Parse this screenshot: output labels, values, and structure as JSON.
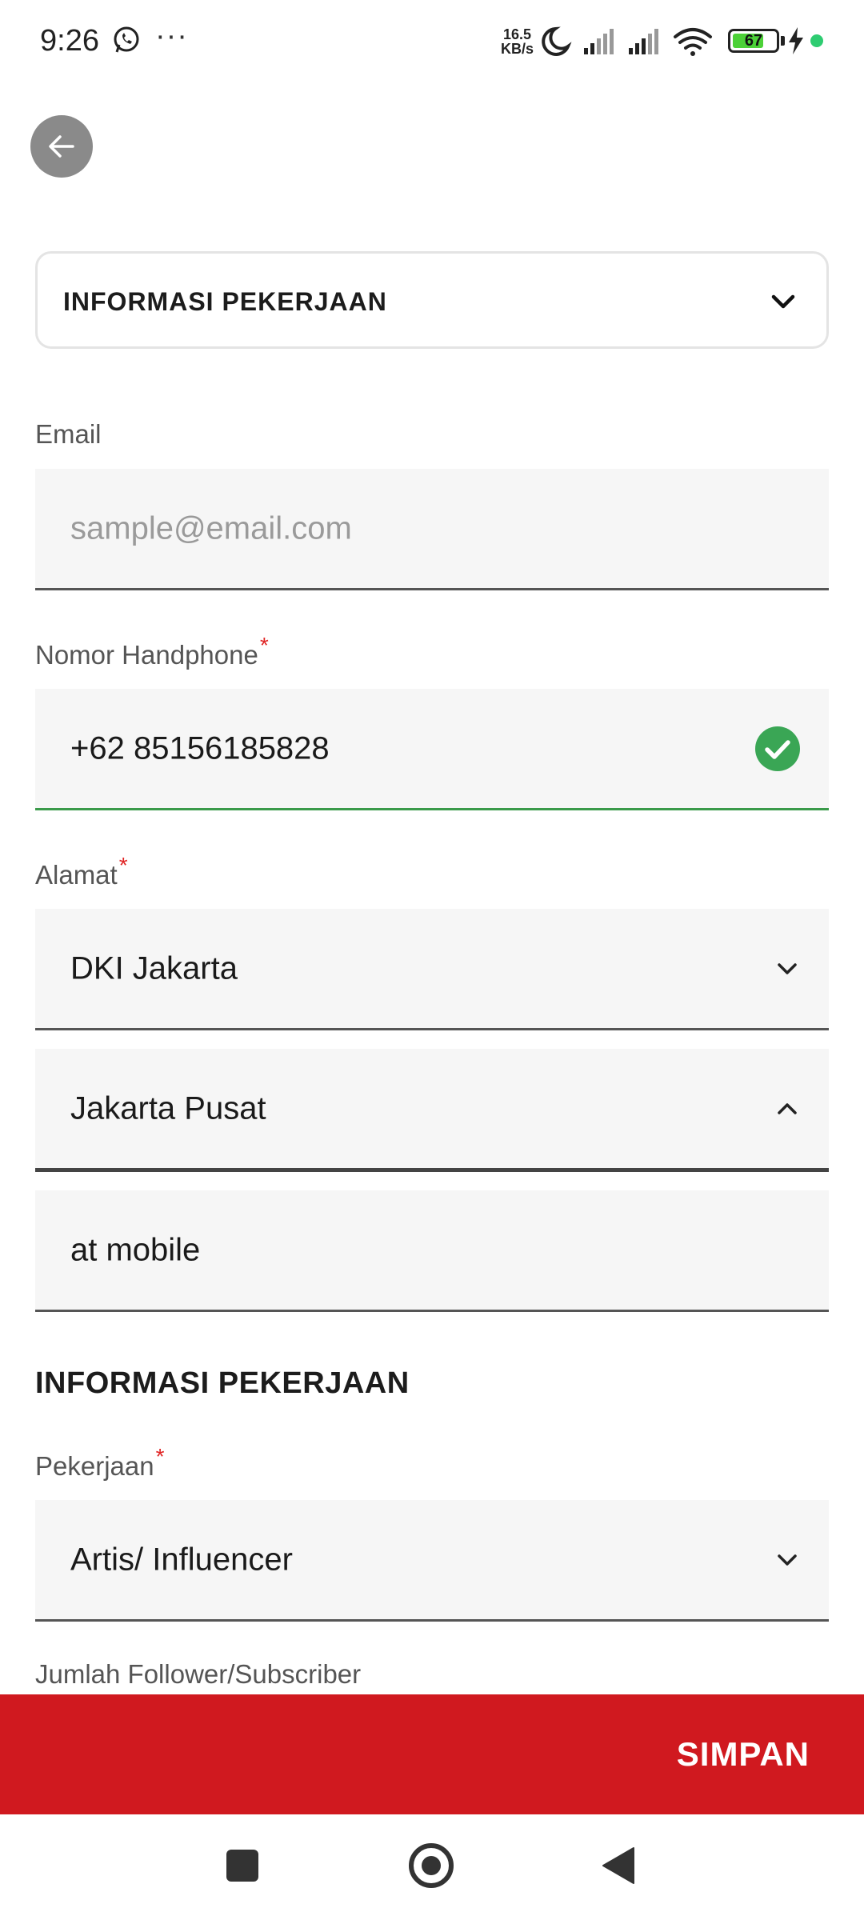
{
  "status_bar": {
    "time": "9:26",
    "more": "···",
    "speed_value": "16.5",
    "speed_unit": "KB/s",
    "battery": "67"
  },
  "accordion": {
    "title": "INFORMASI PEKERJAAN"
  },
  "form": {
    "email": {
      "label": "Email",
      "placeholder": "sample@email.com",
      "value": ""
    },
    "phone": {
      "label": "Nomor Handphone",
      "required_mark": "*",
      "value": "+62  85156185828"
    },
    "address": {
      "label": "Alamat",
      "required_mark": "*",
      "province": "DKI Jakarta",
      "city": "Jakarta Pusat",
      "detail": "at mobile"
    },
    "job_section_heading": "INFORMASI PEKERJAAN",
    "job": {
      "label": "Pekerjaan",
      "required_mark": "*",
      "value": "Artis/ Influencer"
    },
    "followers": {
      "label": "Jumlah Follower/Subscriber"
    }
  },
  "save_button": {
    "label": "SIMPAN"
  },
  "colors": {
    "primary_red": "#d0191f",
    "success_green": "#3a9a4a",
    "required_red": "#e02424"
  }
}
